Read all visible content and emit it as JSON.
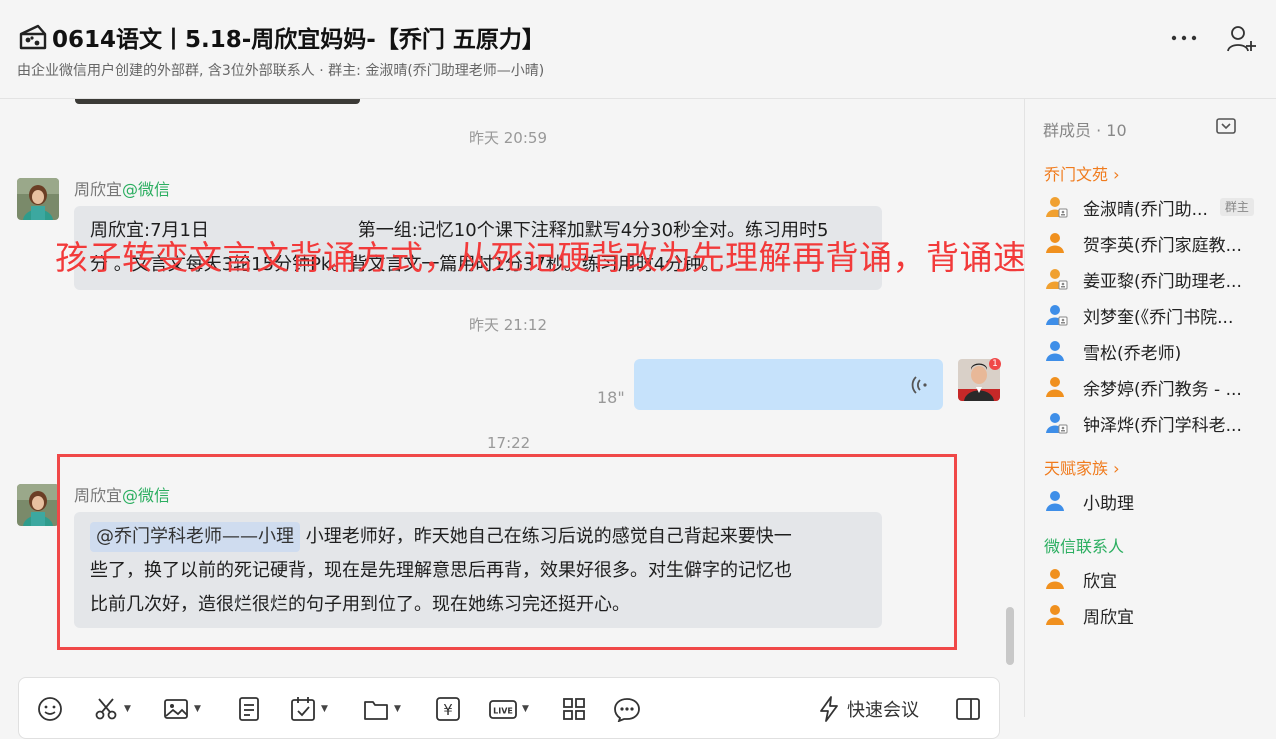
{
  "header": {
    "title": "0614语文丨5.18-周欣宜妈妈-【乔门 五原力】",
    "subtitle": "由企业微信用户创建的外部群, 含3位外部联系人 · 群主: 金淑晴(乔门助理老师—小晴)"
  },
  "overlay_text": "孩子转变文言文背诵方式，从死记硬背改为先理解再背诵，背诵速度、生字记",
  "chat": {
    "messages": [
      {
        "time": "昨天 20:59",
        "sender": "周欣宜",
        "source": "@微信",
        "text_line1": "周欣宜:7月1日                          第一组:记忆10个课下注释加默写4分30秒全对。练习用时5",
        "text_line2": "分 。文言文每天3轮15分钟Pk。背文言文一篇用时1分37秒。练习用时4分钟。"
      },
      {
        "time": "昨天 21:12",
        "voice_duration": "18\"",
        "avatar_badge": "1"
      },
      {
        "time": "17:22",
        "sender": "周欣宜",
        "source": "@微信",
        "mention": "@乔门学科老师——小理",
        "text_first": " 小理老师好，昨天她自己在练习后说的感觉自己背起来要快一",
        "text_line2": "些了，换了以前的死记硬背，现在是先理解意思后再背，效果好很多。对生僻字的记忆也",
        "text_line3": "比前几次好，造很烂很烂的句子用到位了。现在她练习完还挺开心。"
      }
    ]
  },
  "toolbar": {
    "quick_meeting": "快速会议",
    "icons": [
      "emoji-icon",
      "scissors-icon",
      "image-icon",
      "document-icon",
      "calendar-check-icon",
      "folder-icon",
      "yen-icon",
      "live-icon",
      "apps-icon",
      "chat-bot-icon",
      "lightning-icon",
      "panel-icon"
    ],
    "live_label": "LIVE",
    "yen_label": "¥"
  },
  "sidebar": {
    "title": "群成员 · 10",
    "groups": [
      {
        "label": "乔门文苑",
        "chevron": "›",
        "members": [
          {
            "name": "金淑晴(乔门助...",
            "tag": "群主",
            "color": "#f0a030",
            "icon": "user-admin-icon"
          },
          {
            "name": "贺李英(乔门家庭教...",
            "color": "#f0901e",
            "icon": "user-icon"
          },
          {
            "name": "姜亚黎(乔门助理老...",
            "color": "#f0a030",
            "icon": "user-admin-icon"
          },
          {
            "name": "刘梦奎(《乔门书院...",
            "color": "#3e8ee8",
            "icon": "user-admin-icon"
          },
          {
            "name": "雪松(乔老师)",
            "color": "#3e8ee8",
            "icon": "user-icon"
          },
          {
            "name": "余梦婷(乔门教务 - ...",
            "color": "#f0901e",
            "icon": "user-icon"
          },
          {
            "name": "钟泽烨(乔门学科老...",
            "color": "#3e8ee8",
            "icon": "user-admin-icon"
          }
        ]
      },
      {
        "label": "天赋家族",
        "chevron": "›",
        "members": [
          {
            "name": "小助理",
            "color": "#3e8ee8",
            "icon": "user-icon"
          }
        ]
      },
      {
        "label": "微信联系人",
        "members": [
          {
            "name": "欣宜",
            "color": "#f0901e",
            "icon": "user-icon"
          },
          {
            "name": "周欣宜",
            "color": "#f0901e",
            "icon": "user-icon"
          }
        ]
      }
    ]
  },
  "colors": {
    "accent_green": "#2bae60",
    "accent_orange": "#f07b1d",
    "highlight_red": "#f04848",
    "voice_bubble": "#c6e2fb"
  }
}
